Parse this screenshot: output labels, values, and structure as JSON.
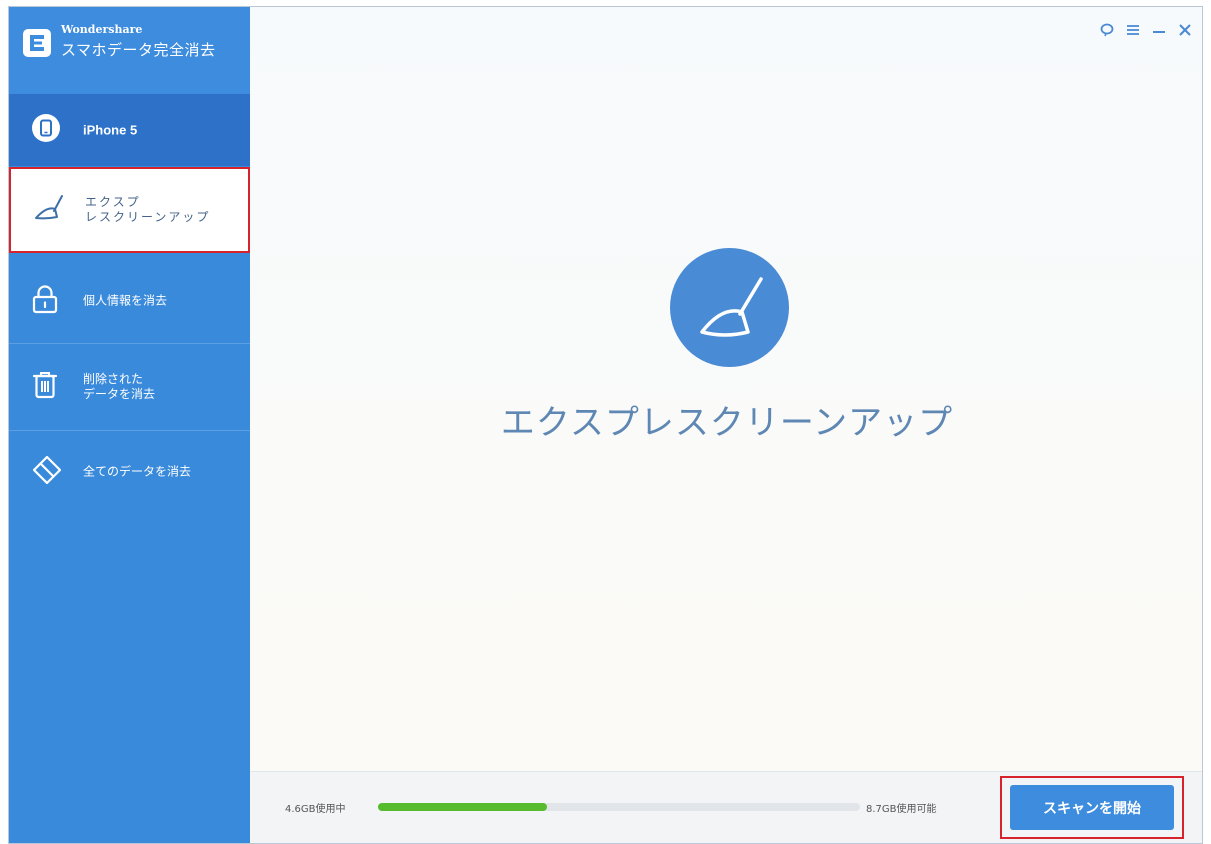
{
  "brand": {
    "small": "Wondershare",
    "name": "スマホデータ完全消去"
  },
  "device": {
    "name": "iPhone 5"
  },
  "sidebar": {
    "items": [
      {
        "label": "エクスプ\nレスクリーンアップ",
        "icon": "broom-icon",
        "active": true
      },
      {
        "label": "個人情報を消去",
        "icon": "lock-icon"
      },
      {
        "label": "削除された\nデータを消去",
        "icon": "trash-icon"
      },
      {
        "label": "全てのデータを消去",
        "icon": "eraser-icon"
      }
    ]
  },
  "window_controls": [
    "feedback-icon",
    "menu-icon",
    "minimize-icon",
    "close-icon"
  ],
  "main": {
    "title": "エクスプレスクリーンアップ",
    "icon": "broom-icon"
  },
  "storage": {
    "used_label": "4.6GB使用中",
    "available_label": "8.7GB使用可能",
    "used_fraction": 0.35
  },
  "actions": {
    "scan_label": "スキャンを開始"
  },
  "colors": {
    "sidebar": "#3a8adb",
    "accent": "#3d8cde",
    "progress": "#56bc2d",
    "highlight": "#d6232c"
  }
}
